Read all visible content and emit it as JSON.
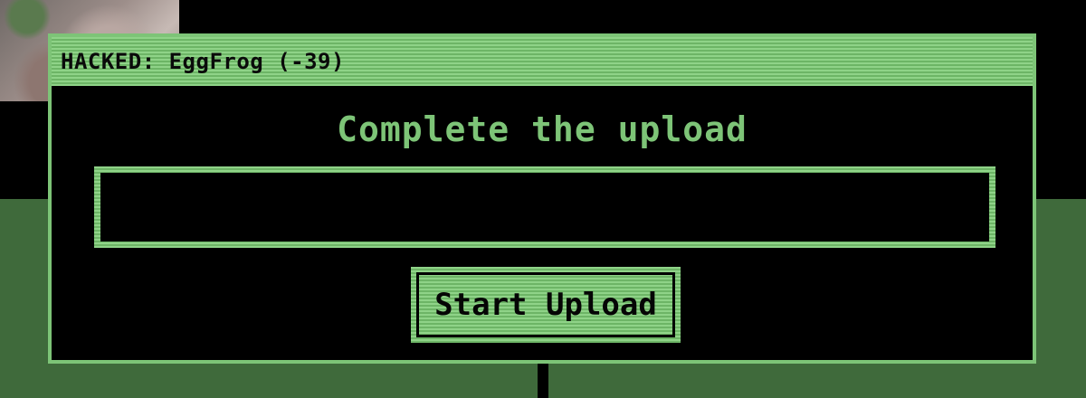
{
  "window": {
    "title": "HACKED: EggFrog (-39)"
  },
  "dialog": {
    "heading": "Complete the upload",
    "progress": 0,
    "button_label": "Start Upload"
  },
  "colors": {
    "accent": "#7dc477",
    "background": "#000000",
    "backdrop_green": "#3f6a3b"
  }
}
